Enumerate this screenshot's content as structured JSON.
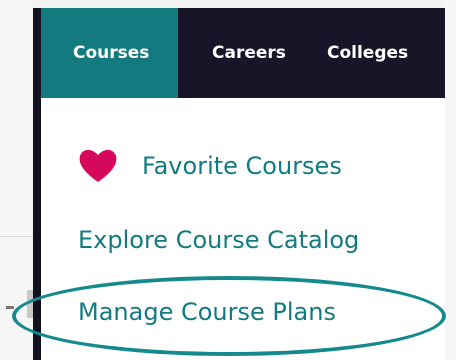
{
  "nav": {
    "tabs": [
      {
        "label": "Courses",
        "active": true
      },
      {
        "label": "Careers",
        "active": false
      },
      {
        "label": "Colleges",
        "active": false
      }
    ]
  },
  "menu": {
    "items": [
      {
        "label": "Favorite Courses",
        "icon": "heart-icon"
      },
      {
        "label": "Explore Course Catalog"
      },
      {
        "label": "Manage Course Plans",
        "highlighted": true
      }
    ]
  },
  "colors": {
    "nav_bg": "#161628",
    "active_tab": "#137b7f",
    "link": "#137b7f",
    "heart": "#d6085c",
    "highlight_ring": "#158a8d"
  }
}
